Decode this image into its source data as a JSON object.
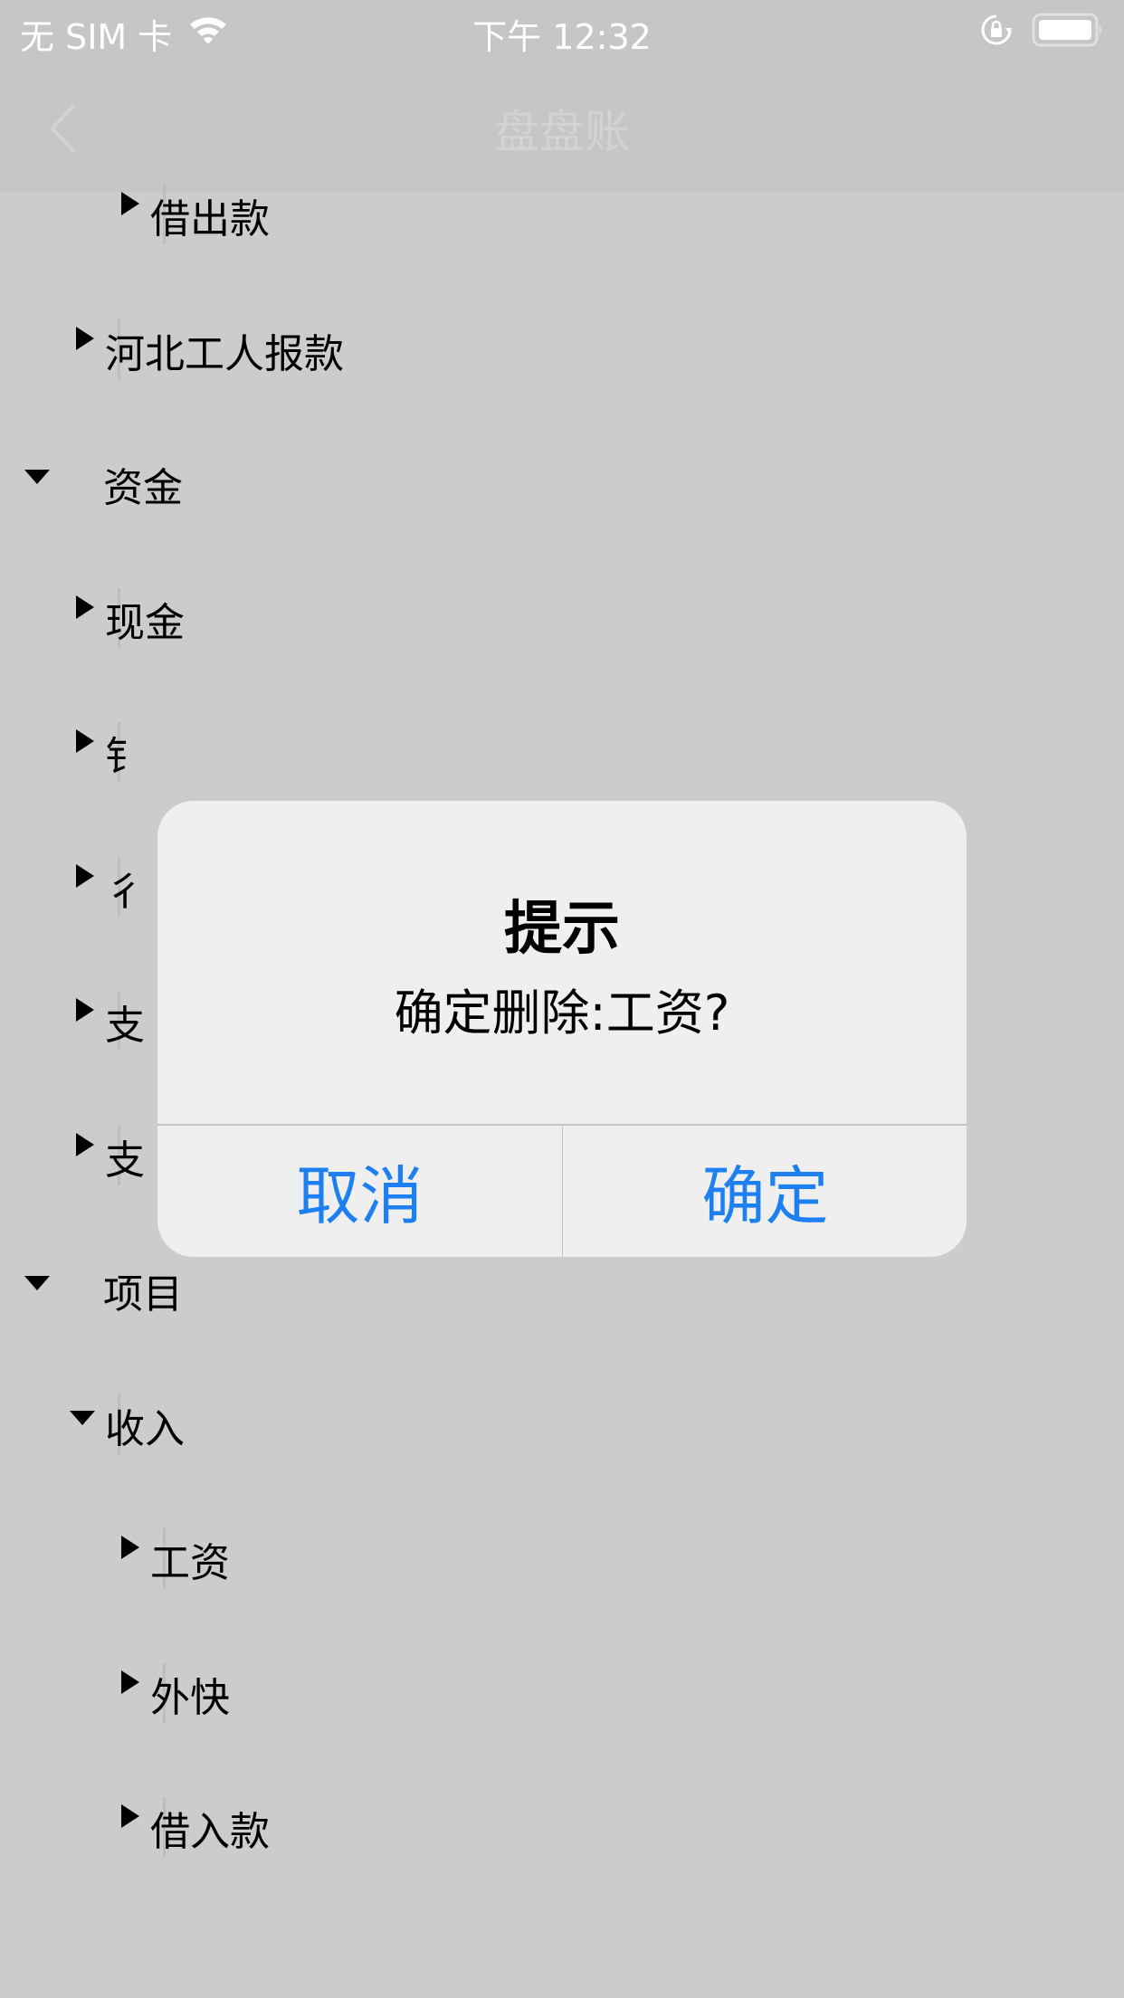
{
  "status_bar": {
    "carrier": "无 SIM 卡",
    "time": "下午 12:32",
    "icons": [
      "wifi-icon",
      "orientation-lock-icon",
      "battery-icon"
    ]
  },
  "nav": {
    "title": "盘盘账",
    "back_icon": "chevron-left-icon"
  },
  "tree": [
    {
      "label": "借出款",
      "level": 2,
      "expanded": false
    },
    {
      "label": "河北工人报款",
      "level": 1,
      "expanded": false
    },
    {
      "label": "资金",
      "level": 0,
      "expanded": true
    },
    {
      "label": "现金",
      "level": 1,
      "expanded": false
    },
    {
      "label": "钅",
      "level": 1,
      "expanded": false
    },
    {
      "label": "彳",
      "level": 1,
      "expanded": false
    },
    {
      "label": "支",
      "level": 1,
      "expanded": false
    },
    {
      "label": "支",
      "level": 1,
      "expanded": false
    },
    {
      "label": "项目",
      "level": 0,
      "expanded": true
    },
    {
      "label": "收入",
      "level": 1,
      "expanded": true
    },
    {
      "label": "工资",
      "level": 2,
      "expanded": false
    },
    {
      "label": "外快",
      "level": 2,
      "expanded": false
    },
    {
      "label": "借入款",
      "level": 2,
      "expanded": false
    }
  ],
  "dialog": {
    "title": "提示",
    "message": "确定删除:工资?",
    "cancel_label": "取消",
    "confirm_label": "确定",
    "button_color": "#1e7ff0"
  }
}
